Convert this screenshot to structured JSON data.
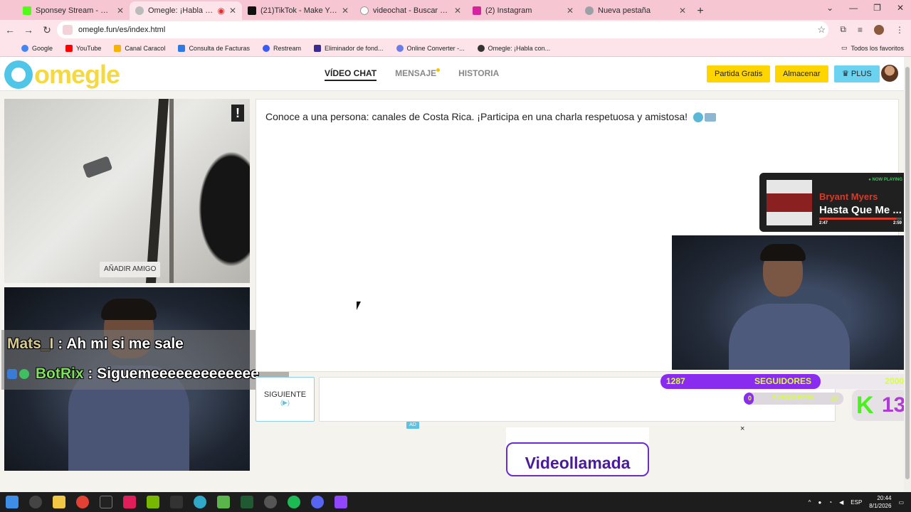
{
  "browser": {
    "tabs": [
      {
        "label": "Sponsey Stream - Watch Live o",
        "color": "#53fc18",
        "active": false
      },
      {
        "label": "Omegle: ¡Habla con Descon",
        "color": "#bbbbbb",
        "active": true
      },
      {
        "label": "(21)TikTok - Make Your Day",
        "color": "#111111",
        "active": false
      },
      {
        "label": "videochat - Buscar con Google",
        "color": "#ffffff",
        "active": false
      },
      {
        "label": "(2) Instagram",
        "color": "#d6249f",
        "active": false
      },
      {
        "label": "Nueva pestaña",
        "color": "#9aa0a6",
        "active": false
      }
    ],
    "url": "omegle.fun/es/index.html",
    "bookmarks": [
      {
        "label": "Google",
        "color": "#4285f4"
      },
      {
        "label": "YouTube",
        "color": "#ff0000"
      },
      {
        "label": "Canal Caracol",
        "color": "#f6b400"
      },
      {
        "label": "Consulta de Facturas",
        "color": "#2c7be5"
      },
      {
        "label": "Restream",
        "color": "#3a5cf5"
      },
      {
        "label": "Eliminador de fond...",
        "color": "#3b2a8f"
      },
      {
        "label": "Online Converter -...",
        "color": "#6a7ee8"
      },
      {
        "label": "Omegle: ¡Habla con...",
        "color": "#333333"
      }
    ],
    "all_bookmarks": "Todos los favoritos"
  },
  "site": {
    "logo": "omegle",
    "nav": [
      "VÍDEO CHAT",
      "MENSAJE",
      "HISTORIA"
    ],
    "btn_free": "Partida Gratis",
    "btn_store": "Almacenar",
    "btn_plus": "PLUS"
  },
  "video": {
    "add_friend": "AÑADIR AMIGO"
  },
  "chat_overlay": {
    "line1_user": "Mats_I",
    "line1_text": ": Ah mi si me sale",
    "line2_user": "BotRix",
    "line2_text": ": Siguemeeeeeeeeeeeee"
  },
  "chat": {
    "intro": "Conoce a una persona: canales de Costa Rica. ¡Participa en una charla respetuosa y amistosa!",
    "next_label": "SIGUIENTE",
    "next_sub": "(▶)"
  },
  "ad": {
    "tag": "AD",
    "close": "×",
    "cta": "Videollamada"
  },
  "now_playing": {
    "tag": "● NOW PLAYING",
    "artist": "Bryant Myers",
    "title": "Hasta Que Me ...",
    "elapsed": "2:47",
    "duration": "2:59",
    "progress": 0.93
  },
  "followers": {
    "current": "1287",
    "label": "SEGUIDORES",
    "goal": "2000",
    "progress": 0.64
  },
  "subs": {
    "current": "0",
    "label": "SUBSCRIBERS",
    "goal": "10",
    "progress": 0.1
  },
  "kick": {
    "letter": "K",
    "number": "13"
  },
  "taskbar": {
    "lang": "ESP",
    "time": "20:44",
    "date": "8/1/2026"
  }
}
